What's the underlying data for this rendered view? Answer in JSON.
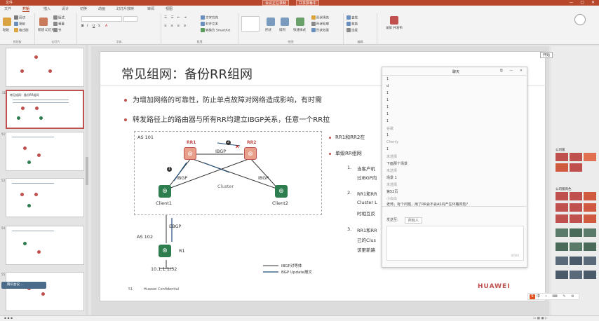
{
  "titlebar": {
    "tabs": [
      "文件",
      "开始",
      "插入",
      "设计",
      "切换",
      "动画",
      "幻灯片放映",
      "审阅",
      "视图"
    ],
    "meeting": [
      "会议正在录制",
      "共享屏幕中"
    ]
  },
  "ribbon": {
    "active_tab": "开始",
    "groups": [
      "剪贴板",
      "幻灯片",
      "字体",
      "段落",
      "绘图",
      "编辑"
    ],
    "buttons": {
      "paste": "粘贴",
      "cut": "剪切",
      "copy": "复制",
      "format_painter": "格式刷",
      "new_slide": "新建\n幻灯片",
      "layout": "版式",
      "reset": "重置",
      "section": "节",
      "text_direction": "文字方向",
      "align_text": "对齐文本",
      "smartart": "转换为 SmartArt",
      "shapes": "形状",
      "arrange": "排列",
      "quick_styles": "快速样式",
      "shape_fill": "形状填充",
      "shape_outline": "形状轮廓",
      "shape_effects": "形状效果",
      "find": "查找",
      "replace": "替换",
      "select": "选择",
      "share": "共享",
      "record": "录屏\n并发布"
    }
  },
  "thumbnails": [
    {
      "num": "",
      "title": ""
    },
    {
      "num": "51",
      "title": "常见组网：备份RR组网"
    },
    {
      "num": "52",
      "title": ""
    },
    {
      "num": "53",
      "title": ""
    },
    {
      "num": "54",
      "title": ""
    },
    {
      "num": "55",
      "title": ""
    }
  ],
  "participant": "腾讯会议 ...",
  "slide": {
    "title": "常见组网：备份RR组网",
    "bullets": [
      "为增加网络的可靠性，防止单点故障对网络造成影响，有时需",
      "转发路径上的路由器与所有RR均建立IBGP关系，任意一个RR拉"
    ],
    "diagram": {
      "as101": "AS 101",
      "as102": "AS 102",
      "rr1": "RR1",
      "rr2": "RR2",
      "ibgp_top": "IBGP",
      "ibgp_left": "IBGP",
      "ibgp_right": "IBGP",
      "cluster": "Cluster",
      "client1": "Client1",
      "client2": "Client2",
      "ebgp": "EBGP",
      "r1": "R1",
      "prefix": "10.1.1.1/32",
      "badge1": "1",
      "badge2": "2"
    },
    "right_bullets": [
      "RR1和RR2在",
      "单级RR组网"
    ],
    "numbered": [
      {
        "n": "1.",
        "lines": [
          "当客户机",
          "过IBGP向"
        ]
      },
      {
        "n": "2.",
        "lines": [
          "RR1和RR",
          "Cluster L",
          "时相互反"
        ]
      },
      {
        "n": "3.",
        "lines": [
          "RR1和RR",
          "己的Clus",
          "该更新路"
        ]
      }
    ],
    "legend": [
      "IBGP对等体",
      "BGP Update报文"
    ],
    "footer_page": "51",
    "footer_text": "Huawei Confidential",
    "brand": "HUAWEI"
  },
  "chat": {
    "title": "聊天",
    "messages": [
      "1",
      "d",
      "1",
      "1",
      "1",
      "1",
      "1",
      "谷歌",
      "1",
      "Chenly",
      "1",
      "未选择",
      "下面那个场景",
      "未选择",
      "场景 1",
      "未选择",
      "第52页",
      "小白白",
      "老师，有个问题，用了RR会不会AS内产生环路风险?"
    ],
    "send_label": "发送至:",
    "send_to": "所有人",
    "char_count": "0/500"
  },
  "right_panel": {
    "label1": "公司版",
    "label2": "公司版商色",
    "start": "开始"
  },
  "ime": "中"
}
